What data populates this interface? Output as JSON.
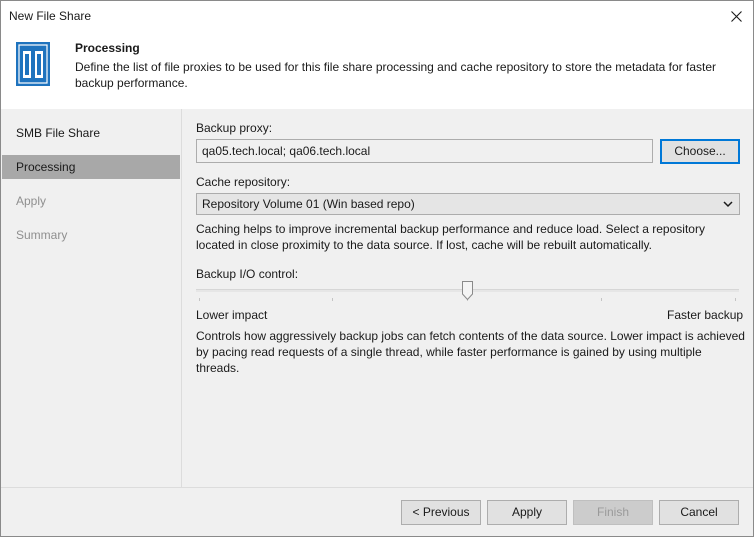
{
  "window": {
    "title": "New File Share"
  },
  "header": {
    "title": "Processing",
    "description": "Define the list of file proxies to be used for this file share processing and cache repository to store the metadata for faster backup performance."
  },
  "nav": {
    "items": [
      {
        "label": "SMB File Share",
        "state": "done"
      },
      {
        "label": "Processing",
        "state": "active"
      },
      {
        "label": "Apply",
        "state": "disabled"
      },
      {
        "label": "Summary",
        "state": "disabled"
      }
    ]
  },
  "proxy": {
    "label": "Backup proxy:",
    "value": "qa05.tech.local; qa06.tech.local",
    "choose_label": "Choose..."
  },
  "cache": {
    "label": "Cache repository:",
    "selected": "Repository Volume 01 (Win based repo)",
    "help": "Caching helps to improve incremental backup performance and reduce load. Select a repository located in close proximity to the data source. If lost, cache will be rebuilt automatically."
  },
  "io": {
    "label": "Backup I/O control:",
    "low_label": "Lower impact",
    "high_label": "Faster backup",
    "level": 0.5,
    "help": "Controls how aggressively backup jobs can fetch contents of the data source. Lower impact is achieved by pacing read requests of a single thread, while faster performance is gained by using multiple threads."
  },
  "footer": {
    "previous_label": "< Previous",
    "apply_label": "Apply",
    "finish_label": "Finish",
    "cancel_label": "Cancel"
  },
  "icons": {
    "close": "close-icon",
    "logo": "file-share-icon",
    "dropdown": "chevron-down-icon",
    "slider": "slider-thumb-icon"
  },
  "colors": {
    "logo_blue": "#1e73be",
    "active_nav": "#a8a8a8",
    "focus_border": "#0078d7"
  }
}
